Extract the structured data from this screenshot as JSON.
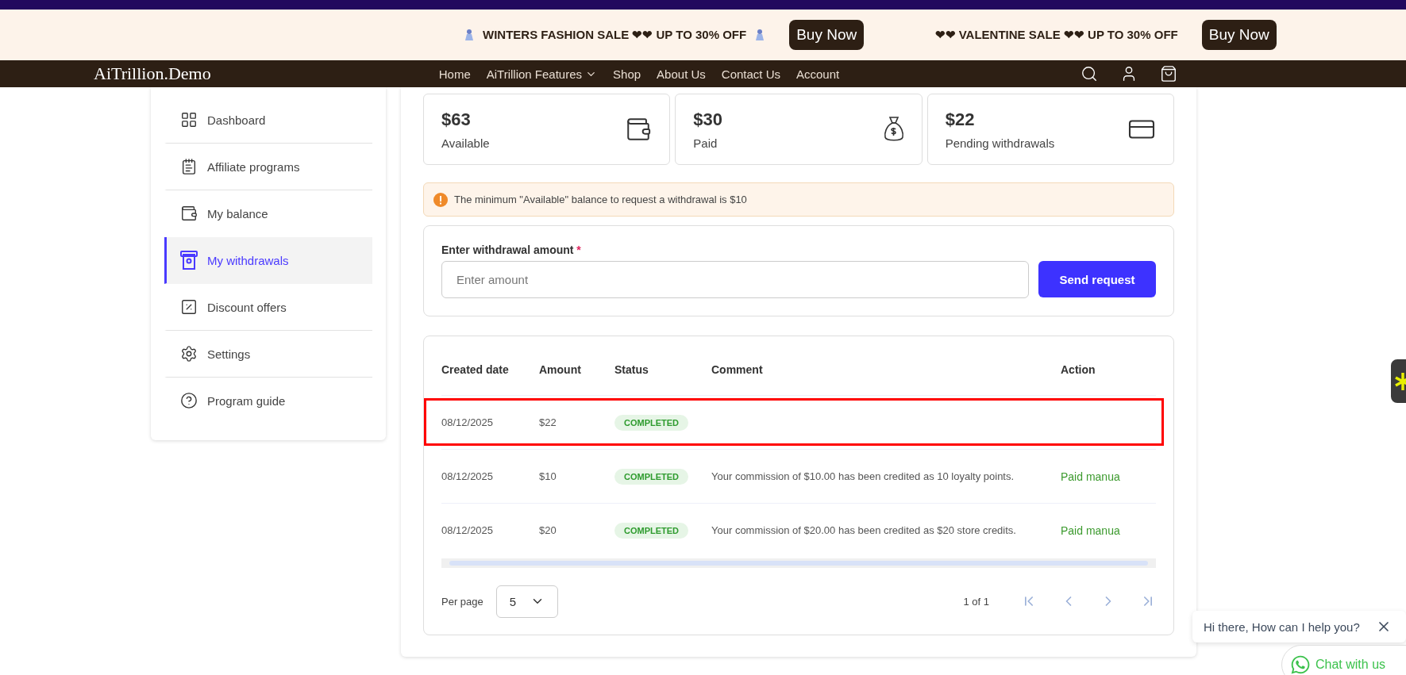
{
  "announcements": [
    {
      "kind": "decorated",
      "text": "WINTERS FASHION SALE ❤❤ UP TO 30% OFF",
      "button": "Buy Now"
    },
    {
      "kind": "plain",
      "text": "❤❤ VALENTINE SALE ❤❤ UP TO 30% OFF",
      "button": "Buy Now"
    }
  ],
  "nav": {
    "logo": "AiTrillion.Demo",
    "links": [
      {
        "label": "Home",
        "dropdown": false
      },
      {
        "label": "AiTrillion Features",
        "dropdown": true
      },
      {
        "label": "Shop",
        "dropdown": false
      },
      {
        "label": "About Us",
        "dropdown": false
      },
      {
        "label": "Contact Us",
        "dropdown": false
      },
      {
        "label": "Account",
        "dropdown": false
      }
    ]
  },
  "sidebar": {
    "items": [
      {
        "label": "Dashboard",
        "selected": false
      },
      {
        "label": "Affiliate programs",
        "selected": false
      },
      {
        "label": "My balance",
        "selected": false
      },
      {
        "label": "My withdrawals",
        "selected": true
      },
      {
        "label": "Discount offers",
        "selected": false
      },
      {
        "label": "Settings",
        "selected": false
      },
      {
        "label": "Program guide",
        "selected": false
      }
    ]
  },
  "stats": [
    {
      "value": "$63",
      "label": "Available"
    },
    {
      "value": "$30",
      "label": "Paid"
    },
    {
      "value": "$22",
      "label": "Pending withdrawals"
    }
  ],
  "alert": "The minimum \"Available\" balance to request a withdrawal is $10",
  "form": {
    "label": "Enter withdrawal amount",
    "required_mark": "*",
    "placeholder": "Enter amount",
    "button": "Send request"
  },
  "table": {
    "columns": [
      "Created date",
      "Amount",
      "Status",
      "Comment",
      "Action"
    ],
    "rows": [
      {
        "date": "08/12/2025",
        "amount": "$22",
        "status": "COMPLETED",
        "highlighted": true
      },
      {
        "date": "08/12/2025",
        "amount": "$10",
        "status": "COMPLETED",
        "comment": "Your commission of $10.00 has been credited as 10 loyalty points.",
        "action": "Paid manua",
        "highlighted": false
      },
      {
        "date": "08/12/2025",
        "amount": "$20",
        "status": "COMPLETED",
        "comment": "Your commission of $20.00 has been credited as $20 store credits.",
        "action": "Paid manua",
        "highlighted": false
      }
    ]
  },
  "pagination": {
    "per_page_label": "Per page",
    "per_page": "5",
    "page_info": "1 of 1"
  },
  "chat": {
    "message": "Hi there, How can I help you?",
    "button": "Chat with us"
  }
}
